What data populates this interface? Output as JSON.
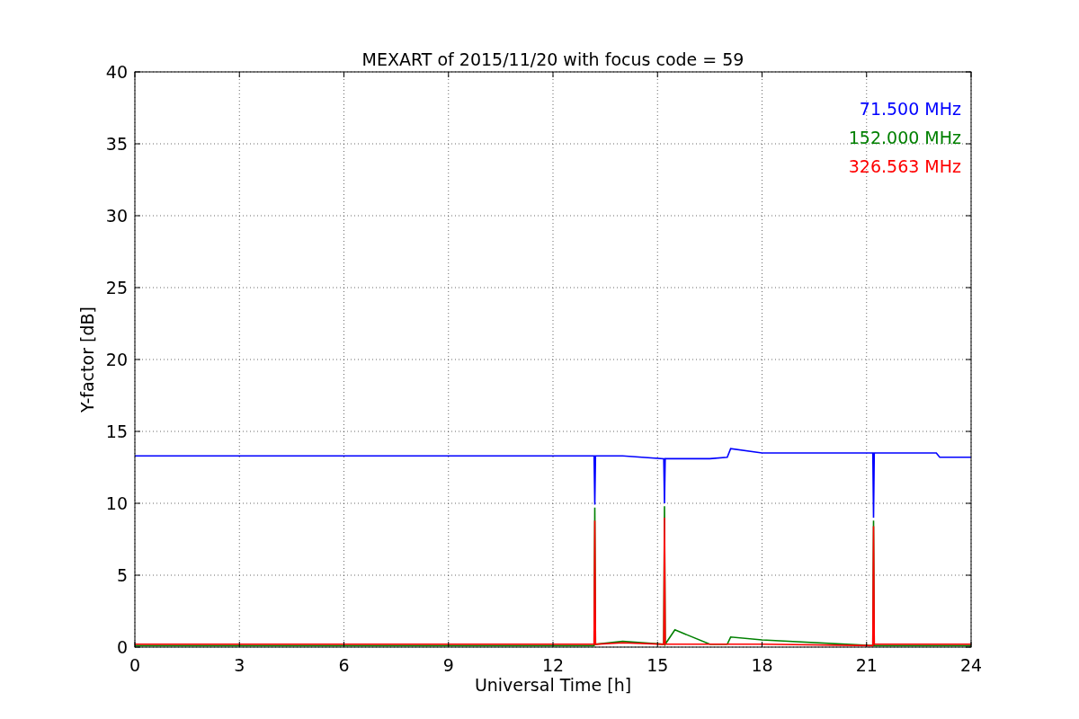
{
  "figure": {
    "chart_data": {
      "type": "line",
      "title": "MEXART of 2015/11/20 with focus code = 59",
      "xlabel": "Universal Time [h]",
      "ylabel": "Y-factor [dB]",
      "x": [
        0,
        0.3,
        12.3,
        13.18,
        13.2,
        13.22,
        14,
        15.18,
        15.2,
        15.22,
        15.5,
        16.5,
        17,
        17.1,
        18,
        21.18,
        21.2,
        21.22,
        23,
        23.1,
        24
      ],
      "series": [
        {
          "name": "71.500 MHz",
          "color": "#0000ff",
          "values": [
            13.3,
            13.3,
            13.3,
            13.3,
            9.9,
            13.3,
            13.3,
            13.1,
            10.0,
            13.1,
            13.1,
            13.1,
            13.2,
            13.8,
            13.5,
            13.5,
            9.0,
            13.5,
            13.5,
            13.2,
            13.2
          ]
        },
        {
          "name": "152.000 MHz",
          "color": "#008000",
          "values": [
            0.1,
            0.1,
            0.1,
            0.1,
            9.7,
            0.2,
            0.4,
            0.2,
            9.8,
            0.2,
            1.2,
            0.2,
            0.2,
            0.7,
            0.5,
            0.1,
            8.8,
            0.1,
            0.1,
            0.1,
            0.1
          ]
        },
        {
          "name": "326.563 MHz",
          "color": "#ff0000",
          "values": [
            0.2,
            0.2,
            0.2,
            0.2,
            8.8,
            0.2,
            0.3,
            0.2,
            9.0,
            0.2,
            0.2,
            0.2,
            0.2,
            0.2,
            0.2,
            0.1,
            8.4,
            0.2,
            0.2,
            0.2,
            0.2
          ]
        }
      ],
      "grid": true,
      "xlim": [
        0,
        24
      ],
      "ylim": [
        0,
        40
      ],
      "xticks": [
        0,
        3,
        6,
        9,
        12,
        15,
        18,
        21,
        24
      ],
      "yticks": [
        0,
        5,
        10,
        15,
        20,
        25,
        30,
        35,
        40
      ]
    }
  }
}
